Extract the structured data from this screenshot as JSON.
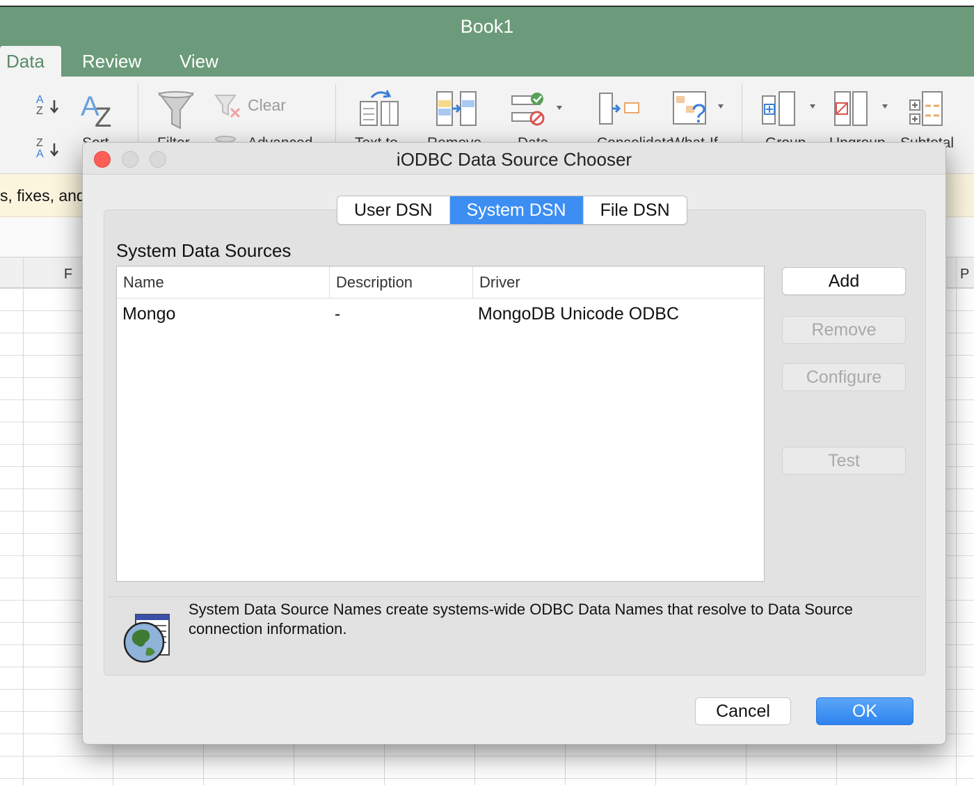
{
  "app": {
    "title": "Book1",
    "ribbon_tabs": [
      {
        "label": "Data",
        "active": true
      },
      {
        "label": "Review"
      },
      {
        "label": "View"
      }
    ],
    "ribbon": {
      "clear_label": "Clear",
      "partial_labels": [
        "Sort",
        "Filter",
        "Advanced",
        "Text to",
        "Remove",
        "Data",
        "Consolidate",
        "What-If",
        "Group",
        "Ungroup",
        "Subtotal"
      ]
    },
    "message_bar_text": "s, fixes, and",
    "column_headers": {
      "left": "F",
      "right": "P"
    },
    "colors": {
      "excel_green": "#6b9b7a",
      "accent_blue": "#3d8ef3"
    }
  },
  "dialog": {
    "title": "iODBC Data Source Chooser",
    "tabs": [
      {
        "label": "User DSN"
      },
      {
        "label": "System DSN",
        "active": true
      },
      {
        "label": "File DSN"
      }
    ],
    "section_title": "System Data Sources",
    "columns": [
      "Name",
      "Description",
      "Driver"
    ],
    "rows": [
      {
        "name": "Mongo",
        "description": "-",
        "driver": "MongoDB Unicode ODBC"
      }
    ],
    "buttons": {
      "add": "Add",
      "remove": "Remove",
      "configure": "Configure",
      "test": "Test"
    },
    "info_text": "System Data Source Names create systems-wide ODBC Data Names that resolve to Data Source connection information.",
    "cancel_label": "Cancel",
    "ok_label": "OK"
  }
}
